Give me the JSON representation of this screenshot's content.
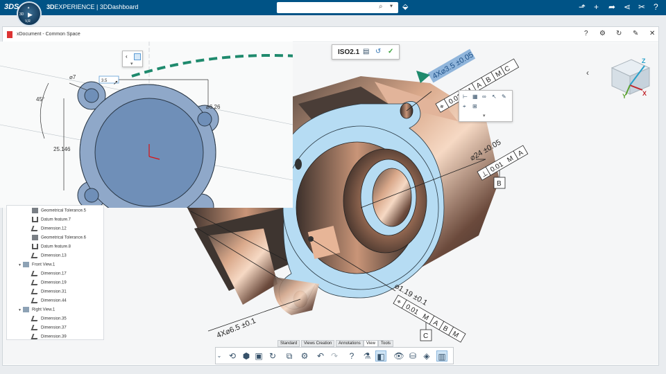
{
  "topbar": {
    "brand_logo": "3DS",
    "brand_prefix": "3D",
    "brand_experience": "EXPERIENCE",
    "app_name": "3DDashboard",
    "compass_top": "3D",
    "compass_v": "V,R",
    "search_placeholder": "",
    "icons": [
      "search-icon",
      "chevron-down-icon",
      "tag-icon",
      "share-icon",
      "plus-icon",
      "forward-icon",
      "network-icon",
      "tools-icon",
      "help-icon"
    ]
  },
  "window": {
    "title": "xDocument - Common Space",
    "header_icons": [
      "help-icon",
      "settings-icon",
      "refresh-icon",
      "pin-icon",
      "close-icon"
    ]
  },
  "annotations": {
    "sketch": {
      "angle_45": "45°",
      "dia_7": "⌀7",
      "dia_6_26": "⌀6.26",
      "dim_25_146": "25.146",
      "field_value": "3.5"
    },
    "iso": {
      "label": "ISO2.1"
    },
    "callouts": {
      "hole_pattern_top": "4X⌀3.5 ±0.05",
      "tol_top": "0.01",
      "datum_a": "A",
      "datum_b": "B",
      "datum_c": "C",
      "modifier_m": "M",
      "bore": "⌀24 ±0.05",
      "tol_perp": "0.01",
      "datum_b_box": "B",
      "pin_dim": "⌀1.19 ±0.1",
      "tol_bottom": "0.01",
      "datum_c_box": "C",
      "hole_pattern_bottom": "4X⌀6.5 ±0.1"
    },
    "nav_cube": {
      "z": "Z",
      "x": "X",
      "y": "Y"
    }
  },
  "tree": {
    "items": [
      {
        "label": "Geometrical Tolerance.5",
        "type": "gtol",
        "level": 2
      },
      {
        "label": "Datum feature.7",
        "type": "datum",
        "level": 2
      },
      {
        "label": "Dimension.12",
        "type": "dim",
        "level": 2
      },
      {
        "label": "Geometrical Tolerance.6",
        "type": "gtol",
        "level": 2
      },
      {
        "label": "Datum feature.8",
        "type": "datum",
        "level": 2
      },
      {
        "label": "Dimension.13",
        "type": "dim",
        "level": 2
      },
      {
        "label": "Front View.1",
        "type": "view",
        "level": 1
      },
      {
        "label": "Dimension.17",
        "type": "dim",
        "level": 2
      },
      {
        "label": "Dimension.19",
        "type": "dim",
        "level": 2
      },
      {
        "label": "Dimension.31",
        "type": "dim",
        "level": 2
      },
      {
        "label": "Dimension.44",
        "type": "dim",
        "level": 2
      },
      {
        "label": "Right View.1",
        "type": "view",
        "level": 1
      },
      {
        "label": "Dimension.35",
        "type": "dim",
        "level": 2
      },
      {
        "label": "Dimension.37",
        "type": "dim",
        "level": 2
      },
      {
        "label": "Dimension.39",
        "type": "dim",
        "level": 2
      }
    ]
  },
  "bottom": {
    "tabs": [
      {
        "label": "Standard",
        "active": false
      },
      {
        "label": "Views Creation",
        "active": false
      },
      {
        "label": "Annotations",
        "active": false
      },
      {
        "label": "View",
        "active": true
      },
      {
        "label": "Tools",
        "active": false
      }
    ],
    "toolbar_icons": [
      "expand-chevron-icon",
      "sketcher-icon",
      "part-icon",
      "save-icon",
      "refresh-icon",
      "copy-icon",
      "settings-icon",
      "undo-icon",
      "redo-icon",
      "help-icon",
      "measure-icon",
      "display-icon",
      "view-icon",
      "material-icon",
      "render-icon",
      "frame-icon"
    ]
  },
  "colors": {
    "topbar": "#005386",
    "selection_blue": "#a9d4ef",
    "arrow_green": "#1f8a6d",
    "sketch_fill": "#6f8fb8"
  }
}
